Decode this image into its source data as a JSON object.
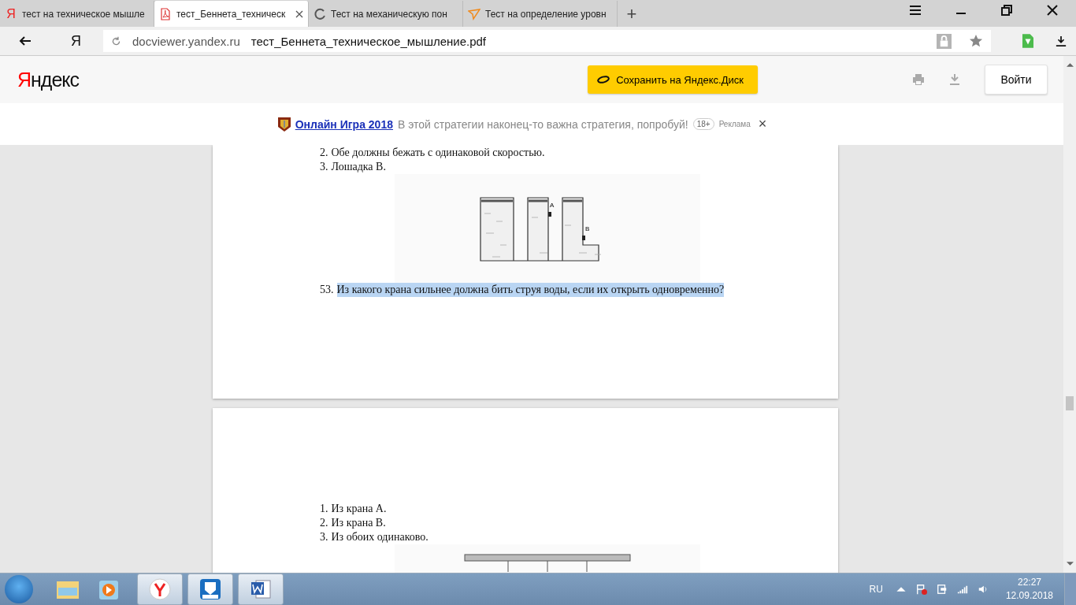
{
  "browser": {
    "tabs": [
      {
        "kind": "yandex",
        "icon_glyph": "Я",
        "title": "тест на техническое мышле",
        "selected": false
      },
      {
        "kind": "pdf",
        "title": "тест_Беннета_техническ",
        "selected": true
      },
      {
        "kind": "loading",
        "title": "Тест на механическую пон",
        "selected": false
      },
      {
        "kind": "plane",
        "title": "Тест на определение уровн",
        "selected": false
      }
    ],
    "new_tab": "+",
    "home_glyph": "Я",
    "address": {
      "domain": "docviewer.yandex.ru",
      "path": "тест_Беннета_техническое_мышление.pdf"
    }
  },
  "viewer_header": {
    "logo": "Яндекс",
    "save_button": "Сохранить на Яндекс.Диск",
    "login_button": "Войти"
  },
  "ad": {
    "link": "Онлайн Игра 2018",
    "text": "В этой стратегии наконец-то важна стратегия, попробуй!",
    "age": "18+",
    "label": "Реклама",
    "close": "×"
  },
  "document": {
    "pages": [
      {
        "blocks": [
          {
            "kind": "line",
            "number": "2.",
            "text": "Обе должны бежать с одинаковой скоростью.",
            "highlighted": false
          },
          {
            "kind": "line",
            "number": "3.",
            "text": "Лошадка В.",
            "highlighted": false
          },
          {
            "kind": "tanks_figure",
            "labels": [
              "А",
              "В"
            ]
          },
          {
            "kind": "line",
            "number": "53.",
            "text": "Из какого крана сильнее должна бить струя воды, если их открыть одновременно?",
            "highlighted": true
          }
        ]
      },
      {
        "blocks": [
          {
            "kind": "line",
            "number": "1.",
            "text": "Из крана А.",
            "highlighted": false
          },
          {
            "kind": "line",
            "number": "2.",
            "text": "Из крана В.",
            "highlighted": false
          },
          {
            "kind": "line",
            "number": "3.",
            "text": "Из обоих одинаково.",
            "highlighted": false
          },
          {
            "kind": "beam_figure"
          }
        ]
      }
    ]
  },
  "taskbar": {
    "tray": {
      "language": "RU",
      "time": "22:27",
      "date": "12.09.2018"
    }
  }
}
